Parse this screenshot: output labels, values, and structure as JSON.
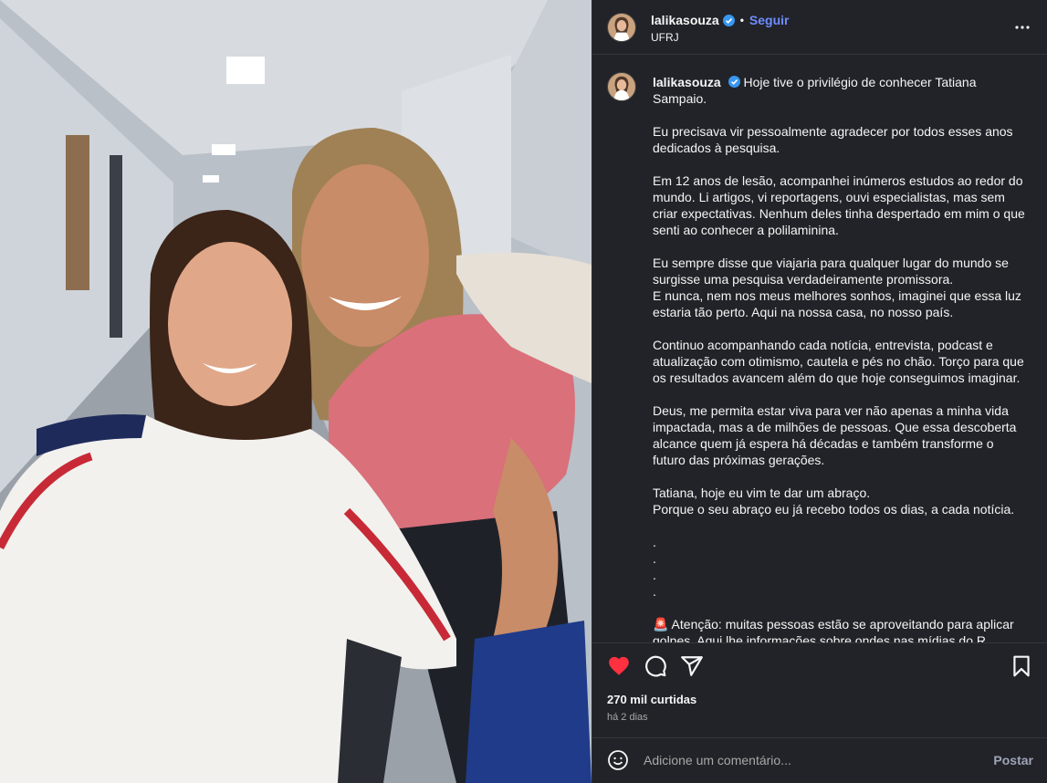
{
  "post": {
    "username": "lalikasouza",
    "follow_label": "Seguir",
    "dot": "•",
    "location": "UFRJ",
    "likes": "270 mil curtidas",
    "time": "há 2 dias"
  },
  "caption": {
    "username": "lalikasouza",
    "lines": [
      "Hoje tive o privilégio de conhecer Tatiana Sampaio.",
      "Eu precisava vir pessoalmente agradecer por todos esses anos dedicados à pesquisa.",
      "Em 12 anos de lesão, acompanhei inúmeros estudos ao redor do mundo. Li artigos, vi reportagens, ouvi especialistas, mas sem criar expectativas. Nenhum deles tinha despertado em mim o que senti ao conhecer a polilaminina.",
      "Eu sempre disse que viajaria para qualquer lugar do mundo se surgisse uma pesquisa verdadeiramente promissora.",
      "E nunca, nem nos meus melhores sonhos, imaginei que essa luz estaria tão perto. Aqui na nossa casa, no nosso país.",
      "Continuo acompanhando cada notícia, entrevista, podcast e atualização com otimismo, cautela e pés no chão. Torço para que os resultados avancem além do que hoje conseguimos imaginar.",
      "Deus, me permita estar viva para ver não apenas a minha vida impactada, mas a de milhões de pessoas. Que essa descoberta alcance quem já espera há décadas e também transforme o futuro das próximas gerações.",
      "Tatiana, hoje eu vim te dar um abraço.",
      "Porque o seu abraço eu já recebo todos os dias, a cada notícia.",
      ".",
      ".",
      ".",
      ".",
      "🚨 Atenção: muitas pessoas estão se aproveitando para aplicar golpes. Aqui lhe informações sobre ondes nas mídias do R..."
    ]
  },
  "comment": {
    "placeholder": "Adicione um comentário...",
    "post_label": "Postar"
  },
  "colors": {
    "panel_bg": "#212328",
    "accent_link": "#6f8cff",
    "like_red": "#ff3040",
    "verified_blue": "#3897f0"
  },
  "icons": [
    "more-options-icon",
    "heart-icon",
    "comment-icon",
    "share-icon",
    "bookmark-icon",
    "emoji-icon",
    "verified-badge-icon"
  ]
}
